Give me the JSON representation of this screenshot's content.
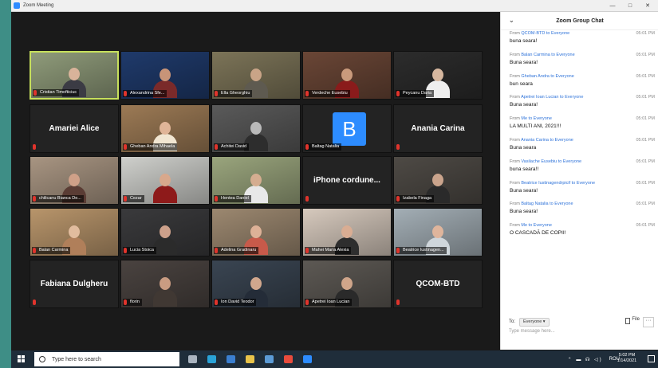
{
  "window": {
    "title": "Zoom Meeting",
    "min": "—",
    "max": "□",
    "close": "✕"
  },
  "tiles": [
    {
      "name": "Cristian Timofticiuc",
      "type": "video",
      "active": true,
      "bg": "#8f9b7a",
      "skin": "#d8b39a",
      "shirt": "#3b3b44"
    },
    {
      "name": "Alexandrina Sfe...",
      "type": "video",
      "bg": "#1f3a6b",
      "skin": "#c89478",
      "shirt": "#7a2a2a"
    },
    {
      "name": "Ella Gheorghiu",
      "type": "video",
      "bg": "#7c7458",
      "skin": "#c9a487",
      "shirt": "#5e5a50"
    },
    {
      "name": "Verdeche Eusebiu",
      "type": "video",
      "bg": "#6a4636",
      "skin": "#c99a7c",
      "shirt": "#8a1b1b"
    },
    {
      "name": "Peycanu Daria",
      "type": "video",
      "bg": "#2c2c2c",
      "skin": "#d6b79f",
      "shirt": "#eeeeee"
    },
    {
      "name": "Amariei Alice",
      "type": "name",
      "bg": "#232323"
    },
    {
      "name": "Gheban Andra Mihaela",
      "type": "video",
      "bg": "#9c7a55",
      "skin": "#e0b598",
      "shirt": "#f1e6d2"
    },
    {
      "name": "Achitei David",
      "type": "video",
      "bg": "#5a5a5a",
      "skin": "#b9b9b9",
      "shirt": "#2d2d2d"
    },
    {
      "name": "Baltag Natalia",
      "type": "avatar",
      "letter": "B",
      "bg": "#232323"
    },
    {
      "name": "Anania Carina",
      "type": "name",
      "bg": "#232323"
    },
    {
      "name": "chilicanu Bianca De...",
      "type": "video",
      "bg": "#a89582",
      "skin": "#cfa088",
      "shirt": "#5a3c34"
    },
    {
      "name": "Cezar",
      "type": "video",
      "bg": "#cfd0cc",
      "skin": "#d8a88c",
      "shirt": "#8e1a1a"
    },
    {
      "name": "Hentea Daniel",
      "type": "video",
      "bg": "#9aa57d",
      "skin": "#d5ad90",
      "shirt": "#e8e8e8"
    },
    {
      "name": "iPhone cordune...",
      "type": "name",
      "bg": "#232323"
    },
    {
      "name": "Izabela Finaga",
      "type": "video",
      "bg": "#4e4a45",
      "skin": "#caa48c",
      "shirt": "#2a2a2a"
    },
    {
      "name": "Balan Carmina",
      "type": "video",
      "bg": "#b8956b",
      "skin": "#e1bc9e",
      "shirt": "#b07f5a"
    },
    {
      "name": "Lucia Stoica",
      "type": "video",
      "bg": "#3a3a3c",
      "skin": "#cda18b",
      "shirt": "#2b2b2b"
    },
    {
      "name": "Adelina Gradinaru",
      "type": "video",
      "bg": "#9c8870",
      "skin": "#ddb197",
      "shirt": "#c85a4a"
    },
    {
      "name": "Mahei Maria Alexia",
      "type": "video",
      "bg": "#d6c9bd",
      "skin": "#d9ad93",
      "shirt": "#2e2e2e"
    },
    {
      "name": "Beatrice Iustinagen...",
      "type": "video",
      "bg": "#a3aeb5",
      "skin": "#dfb59c",
      "shirt": "#cfd6db"
    },
    {
      "name": "Fabiana Dulgheru",
      "type": "name",
      "bg": "#232323"
    },
    {
      "name": "florin",
      "type": "video",
      "bg": "#4a4340",
      "skin": "#c99c82",
      "shirt": "#403833"
    },
    {
      "name": "Ion David Teodor",
      "type": "video",
      "bg": "#3a4552",
      "skin": "#d1a78d",
      "shirt": "#242c38"
    },
    {
      "name": "Apetrei Ioan Lucian",
      "type": "video",
      "bg": "#5d5954",
      "skin": "#cfa58a",
      "shirt": "#2a2a2a"
    },
    {
      "name": "QCOM-BTD",
      "type": "name",
      "bg": "#232323"
    }
  ],
  "chat": {
    "title": "Zoom Group Chat",
    "messages": [
      {
        "from": "QCOM-BTD",
        "to": "Everyone",
        "time": "05:01 PM",
        "text": "buna seara!"
      },
      {
        "from": "Balan Carmina",
        "to": "Everyone",
        "time": "05:01 PM",
        "text": "Buna seara!"
      },
      {
        "from": "Gheban Andra",
        "to": "Everyone",
        "time": "05:01 PM",
        "text": "bun seara"
      },
      {
        "from": "Apetrei Ioan Lucian",
        "to": "Everyone",
        "time": "05:01 PM",
        "text": "Buna seara!"
      },
      {
        "from": "Me",
        "to": "Everyone",
        "time": "05:01 PM",
        "text": "LA MULTI ANI, 2021!!!"
      },
      {
        "from": "Anania Carina",
        "to": "Everyone",
        "time": "05:01 PM",
        "text": "Buna seara"
      },
      {
        "from": "Vasilache Eusebiu",
        "to": "Everyone",
        "time": "05:01 PM",
        "text": "buna seara!!"
      },
      {
        "from": "Beatrice Iustinagendrpicif",
        "to": "Everyone",
        "time": "05:01 PM",
        "text": "Buna seara!"
      },
      {
        "from": "Baltag Natalia",
        "to": "Everyone",
        "time": "05:01 PM",
        "text": "Buna seara!"
      },
      {
        "from": "Me",
        "to": "Everyone",
        "time": "05:01 PM",
        "text": "O CASCADĂ DE COPII!"
      }
    ],
    "from_label": "From",
    "to_label": "to",
    "to_prefix": "To:",
    "recipient": "Everyone ▾",
    "file_label": "File",
    "more_label": "···",
    "placeholder": "Type message here..."
  },
  "taskbar": {
    "search_placeholder": "Type here to search",
    "apps": [
      {
        "icon": "task-view-icon",
        "color": "#aab4c0"
      },
      {
        "icon": "edge-icon",
        "color": "#2aa3d8"
      },
      {
        "icon": "mail-icon",
        "color": "#3b7fd0"
      },
      {
        "icon": "file-explorer-icon",
        "color": "#e8c34a"
      },
      {
        "icon": "store-icon",
        "color": "#5c9bd6"
      },
      {
        "icon": "chrome-icon",
        "color": "#e84b3c"
      },
      {
        "icon": "zoom-icon",
        "color": "#2d8cff"
      }
    ],
    "tray_icons": "⌃ ▬ ☊ ◁)",
    "lang": "ROU",
    "time": "5:02 PM",
    "date": "1/14/2021"
  }
}
